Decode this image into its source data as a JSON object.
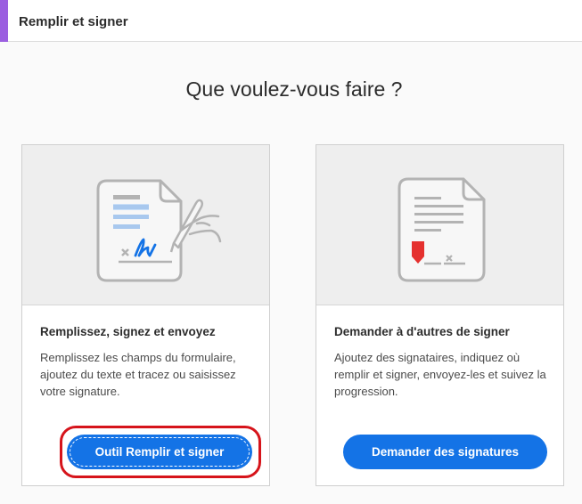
{
  "header": {
    "title": "Remplir et signer",
    "accent_color": "#9b5fe0"
  },
  "main": {
    "question": "Que voulez-vous faire ?"
  },
  "cards": [
    {
      "title": "Remplissez, signez et envoyez",
      "description": "Remplissez les champs du formulaire, ajoutez du texte et tracez ou saisissez votre signature.",
      "button_label": "Outil Remplir et signer",
      "icon": "fill-sign-document-icon"
    },
    {
      "title": "Demander à d'autres de signer",
      "description": "Ajoutez des signataires, indiquez où remplir et signer, envoyez-les et suivez la progression.",
      "button_label": "Demander des signatures",
      "icon": "request-signatures-document-icon"
    }
  ],
  "colors": {
    "button": "#1473e6",
    "highlight": "#d6141b",
    "marker": "#e5312f"
  }
}
